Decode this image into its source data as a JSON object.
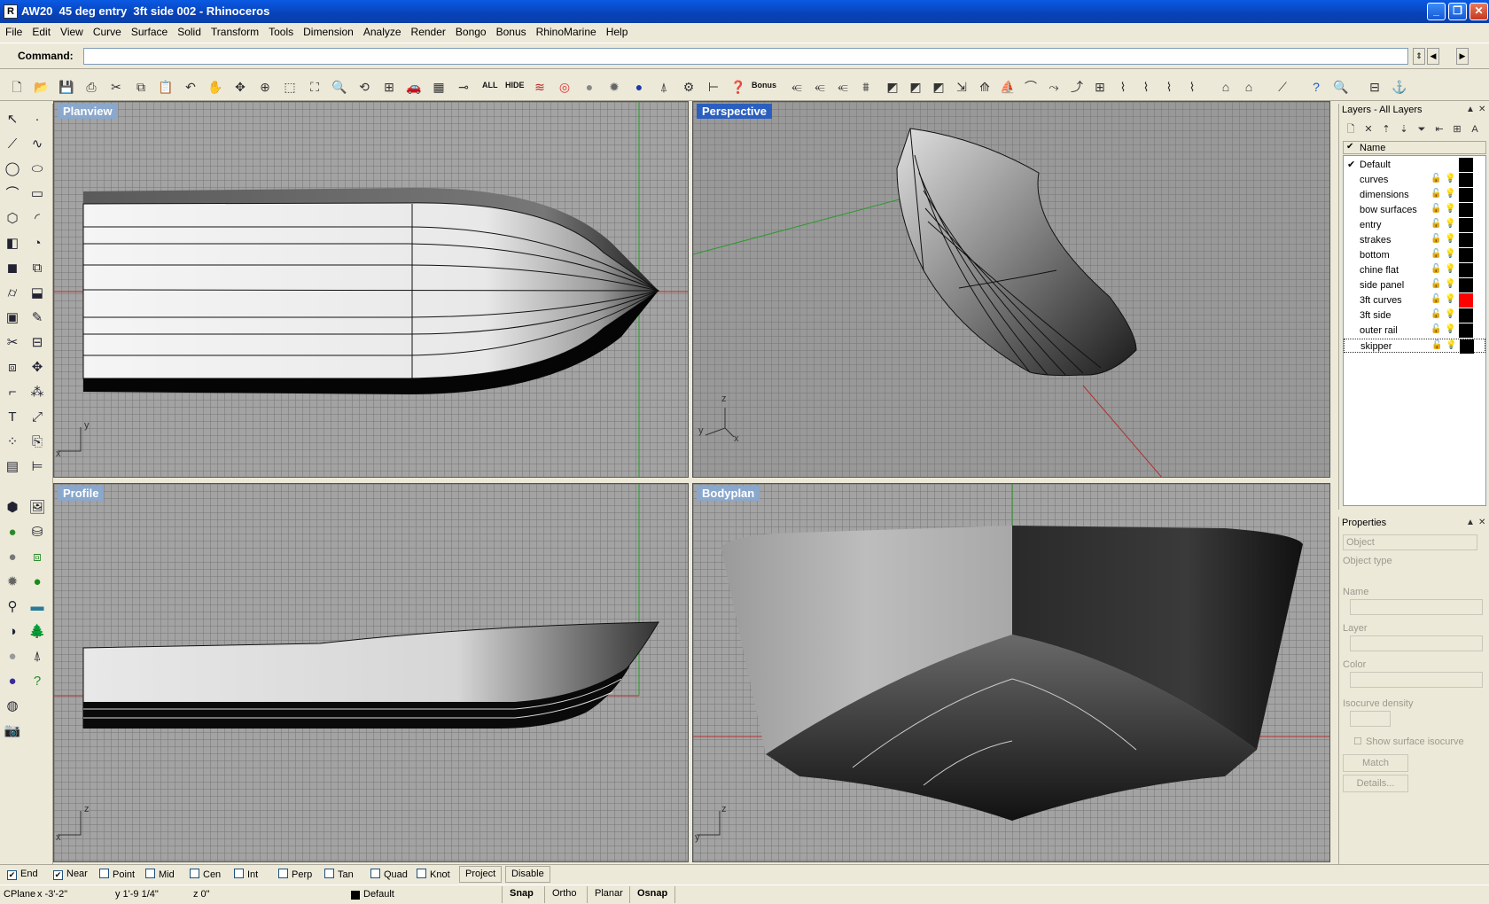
{
  "window": {
    "title": "AW20  45 deg entry  3ft side 002 - Rhinoceros"
  },
  "menu": [
    "File",
    "Edit",
    "View",
    "Curve",
    "Surface",
    "Solid",
    "Transform",
    "Tools",
    "Dimension",
    "Analyze",
    "Render",
    "Bongo",
    "Bonus",
    "RhinoMarine",
    "Help"
  ],
  "command": {
    "label": "Command:",
    "value": ""
  },
  "toolbar": {
    "all_label": "ALL",
    "hide_label": "HIDE",
    "bonus_label": "Bonus"
  },
  "viewports": {
    "planview": {
      "label": "Planview",
      "axis1": "y",
      "axis2": "x"
    },
    "perspective": {
      "label": "Perspective",
      "axis1": "z",
      "axis2": "y",
      "axis3": "x"
    },
    "profile": {
      "label": "Profile",
      "axis1": "z",
      "axis2": "x"
    },
    "bodyplan": {
      "label": "Bodyplan",
      "axis1": "z",
      "axis2": "y"
    }
  },
  "layers": {
    "title": "Layers - All Layers",
    "header": "Name",
    "items": [
      {
        "name": "Default",
        "checked": true,
        "color": "#000000"
      },
      {
        "name": "curves",
        "color": "#000000"
      },
      {
        "name": "dimensions",
        "color": "#000000"
      },
      {
        "name": "bow surfaces",
        "color": "#000000"
      },
      {
        "name": "entry",
        "color": "#000000"
      },
      {
        "name": "strakes",
        "color": "#000000"
      },
      {
        "name": "bottom",
        "color": "#000000"
      },
      {
        "name": "chine flat",
        "color": "#000000"
      },
      {
        "name": "side panel",
        "color": "#000000"
      },
      {
        "name": "3ft curves",
        "color": "#ff0000"
      },
      {
        "name": "3ft side",
        "color": "#000000"
      },
      {
        "name": "outer rail",
        "color": "#000000"
      },
      {
        "name": "skipper",
        "color": "#000000"
      }
    ]
  },
  "properties": {
    "title": "Properties",
    "object_select": "Object",
    "object_type": "Object type",
    "name_label": "Name",
    "layer_label": "Layer",
    "color_label": "Color",
    "isocurve_label": "Isocurve density",
    "show_isocurve": "Show surface isocurve",
    "match_button": "Match",
    "details_button": "Details..."
  },
  "osnap": {
    "items": [
      {
        "label": "End",
        "checked": true
      },
      {
        "label": "Near",
        "checked": true
      },
      {
        "label": "Point",
        "checked": false
      },
      {
        "label": "Mid",
        "checked": false
      },
      {
        "label": "Cen",
        "checked": false
      },
      {
        "label": "Int",
        "checked": false
      },
      {
        "label": "Perp",
        "checked": false
      },
      {
        "label": "Tan",
        "checked": false
      },
      {
        "label": "Quad",
        "checked": false
      },
      {
        "label": "Knot",
        "checked": false
      }
    ],
    "project": "Project",
    "disable": "Disable"
  },
  "status": {
    "cplane": "CPlane",
    "x": "x -3'-2\"",
    "y": "y 1'-9 1/4\"",
    "z": "z 0\"",
    "layer": "Default",
    "snap": "Snap",
    "ortho": "Ortho",
    "planar": "Planar",
    "osnap": "Osnap"
  }
}
